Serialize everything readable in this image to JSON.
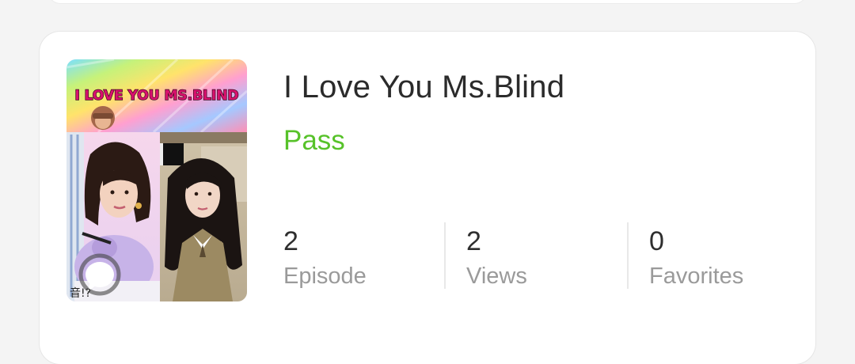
{
  "comic": {
    "title": "I Love You Ms.Blind",
    "status": "Pass",
    "status_color": "#57c22a",
    "cover": {
      "banner_text": "I LOVE YOU MS.BLIND",
      "caption": "音!?"
    }
  },
  "stats": [
    {
      "value": "2",
      "label": "Episode"
    },
    {
      "value": "2",
      "label": "Views"
    },
    {
      "value": "0",
      "label": "Favorites"
    }
  ]
}
